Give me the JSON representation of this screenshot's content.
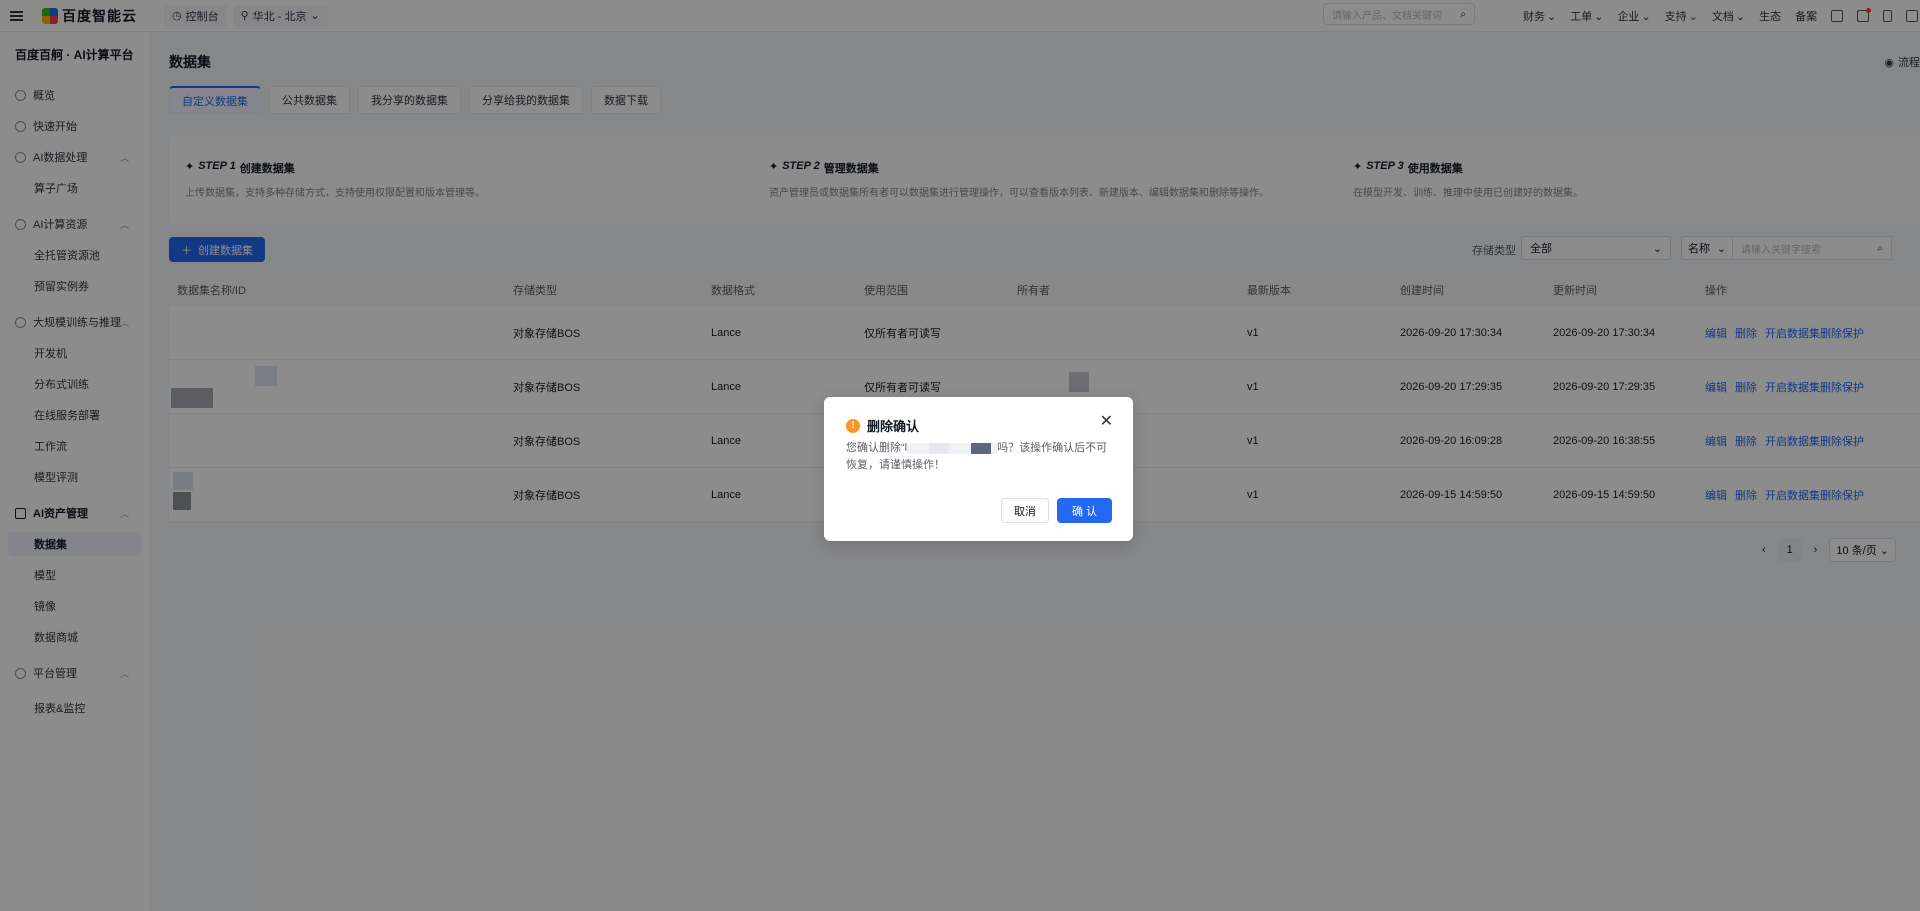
{
  "topbar": {
    "logo": "百度智能云",
    "console": "控制台",
    "region": "华北 - 北京",
    "search_placeholder": "请输入产品、文档关键词",
    "menu": [
      "财务",
      "工单",
      "企业",
      "支持",
      "文档",
      "生态",
      "备案"
    ]
  },
  "sidebar": {
    "title": "百度百舸 · AI计算平台",
    "items": [
      {
        "label": "概览",
        "type": "group"
      },
      {
        "label": "快速开始",
        "type": "group"
      },
      {
        "label": "AI数据处理",
        "type": "group"
      },
      {
        "label": "算子广场",
        "type": "sub"
      },
      {
        "label": "AI计算资源",
        "type": "group"
      },
      {
        "label": "全托管资源池",
        "type": "sub"
      },
      {
        "label": "预留实例券",
        "type": "sub"
      },
      {
        "label": "大规模训练与推理",
        "type": "group"
      },
      {
        "label": "开发机",
        "type": "sub"
      },
      {
        "label": "分布式训练",
        "type": "sub"
      },
      {
        "label": "在线服务部署",
        "type": "sub"
      },
      {
        "label": "工作流",
        "type": "sub"
      },
      {
        "label": "模型评测",
        "type": "sub"
      },
      {
        "label": "AI资产管理",
        "type": "group"
      },
      {
        "label": "数据集",
        "type": "sub"
      },
      {
        "label": "模型",
        "type": "sub"
      },
      {
        "label": "镜像",
        "type": "sub"
      },
      {
        "label": "数据商城",
        "type": "sub"
      },
      {
        "label": "平台管理",
        "type": "group"
      },
      {
        "label": "报表&监控",
        "type": "sub"
      }
    ]
  },
  "main": {
    "title": "数据集",
    "flow_link": "流程",
    "tabs": [
      "自定义数据集",
      "公共数据集",
      "我分享的数据集",
      "分享给我的数据集",
      "数据下载"
    ],
    "steps": [
      {
        "num": "STEP 1",
        "title": "创建数据集",
        "desc": "上传数据集，支持多种存储方式，支持使用权限配置和版本管理等。"
      },
      {
        "num": "STEP 2",
        "title": "管理数据集",
        "desc": "资产管理员或数据集所有者可以数据集进行管理操作，可以查看版本列表、新建版本、编辑数据集和删除等操作。"
      },
      {
        "num": "STEP 3",
        "title": "使用数据集",
        "desc": "在模型开发、训练、推理中使用已创建好的数据集。"
      }
    ],
    "create_button": "创建数据集",
    "filter_label": "存储类型",
    "filter_value": "全部",
    "name_select": "名称",
    "keyword_placeholder": "请输入关键字搜索"
  },
  "table": {
    "headers": [
      "数据集名称/ID",
      "存储类型",
      "数据格式",
      "使用范围",
      "所有者",
      "最新版本",
      "创建时间",
      "更新时间",
      "操作"
    ],
    "rows": [
      {
        "storage": "对象存储BOS",
        "format": "Lance",
        "scope": "仅所有者可读写",
        "version": "v1",
        "created": "2026-09-20 17:30:34",
        "updated": "2026-09-20 17:30:34"
      },
      {
        "storage": "对象存储BOS",
        "format": "Lance",
        "scope": "仅所有者可读写",
        "version": "v1",
        "created": "2026-09-20 17:29:35",
        "updated": "2026-09-20 17:29:35"
      },
      {
        "storage": "对象存储BOS",
        "format": "Lance",
        "scope": "",
        "version": "v1",
        "created": "2026-09-20 16:09:28",
        "updated": "2026-09-20 16:38:55"
      },
      {
        "storage": "对象存储BOS",
        "format": "Lance",
        "scope": "",
        "version": "v1",
        "created": "2026-09-15 14:59:50",
        "updated": "2026-09-15 14:59:50"
      }
    ],
    "ops": [
      "编辑",
      "删除",
      "开启数据集删除保护"
    ]
  },
  "pager": {
    "page": "1",
    "size": "10 条/页"
  },
  "modal": {
    "title": "删除确认",
    "prefix": "您确认删除“l",
    "suffix": "吗？该操作确认后不可恢复，请谨慎操作！",
    "cancel": "取消",
    "confirm": "确 认"
  }
}
